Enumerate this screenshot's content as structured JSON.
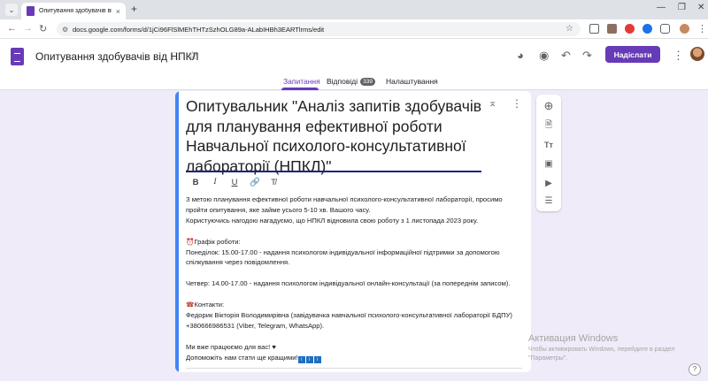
{
  "browser": {
    "tab_title": "Опитування здобувачів від Н",
    "tab_close": "×",
    "new_tab": "+",
    "url": "docs.google.com/forms/d/1jCi96FlSlMEhTHTzSzhOLG89a-ALabIHBh3EARTlrms/edit",
    "window_controls": [
      "—",
      "❐",
      "✕"
    ]
  },
  "form_header": {
    "form_name": "Опитування здобувачів від НПКЛ",
    "send_label": "Надіслати",
    "tabs": [
      {
        "label": "Запитання",
        "active": true
      },
      {
        "label": "Відповіді",
        "badge": "339"
      },
      {
        "label": "Налаштування"
      }
    ]
  },
  "card": {
    "title": "Опитувальник \"Аналіз запитів здобувачів для планування ефективної роботи Навчальної психолого-консультативної лабораторії (НПКЛ)\"",
    "format_buttons": [
      "B",
      "I",
      "U",
      "🔗",
      "T̸"
    ],
    "description": {
      "intro": "З метою планування ефективної роботи навчальної психолого-консультативної лабораторії, просимо пройти опитування, яке займе усього 5-10 хв. Вашого часу.",
      "reminder": "Користуючись нагодою нагадуємо, що НПКЛ відновила свою роботу з 1 листопада 2023 року.",
      "schedule_heading": "Графік роботи:",
      "monday": "Понеділок: 15.00-17.00 - надання психологом індивідуальної інформаційної підтримки за допомогою спілкування через повідомлення.",
      "thursday": "Четвер: 14.00-17.00 - надання психологом індивідуальної онлайн-консультації (за попереднім записом).",
      "contacts_heading": "Контакти:",
      "contact_name": "Федорик Вікторія Володимирівна (завідувачка навчальної психолого-консультативної лабораторії БДПУ)",
      "contact_phone": "+380666986531 (Viber, Telegram, WhatsApp).",
      "closing1": "Ми вже працюємо для вас! ♥",
      "closing2": "Допоможіть нам стати ще кращими!"
    }
  },
  "watermark": {
    "title": "Активация Windows",
    "subtitle": "Чтобы активировать Windows, перейдите в раздел \"Параметры\"."
  },
  "colors": {
    "brand": "#673ab7",
    "background": "#f0ebf8",
    "active_edge": "#4285f4"
  }
}
